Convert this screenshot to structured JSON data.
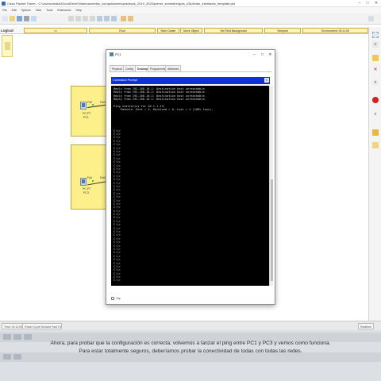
{
  "window": {
    "title": "Cisco Packet Tracer - C:\\Users\\cristia\\iCloudDrive\\Sistemas\\redes_computadores\\practicas_2019_2020\\primer_semestre\\guia_03\\pt\\vlan_interfaces_template.pkt"
  },
  "menu": [
    "File",
    "Edit",
    "Options",
    "View",
    "Tools",
    "Extensions",
    "Help"
  ],
  "workspace": {
    "mode": "Logical",
    "root": "Root",
    "new_cluster": "New Cluster",
    "move_object": "Move Object",
    "set_tiled_background": "Set Tiled Background",
    "viewport": "Viewport",
    "environment": "Environment: 00:11:00"
  },
  "topology": {
    "devices": [
      {
        "label": "PC-PT",
        "name": "PC1",
        "port": "Fa0",
        "switch_port": "Fa0/2"
      },
      {
        "label": "PC-PT",
        "name": "PC3",
        "port": "Fa0",
        "switch_port": "Fa0/4"
      }
    ]
  },
  "dialog": {
    "title": "PC1",
    "tabs": [
      "Physical",
      "Config",
      "Desktop",
      "Programming",
      "Attributes"
    ],
    "active_tab": "Desktop",
    "panel_title": "Command Prompt",
    "panel_close": "X",
    "terminal_lines": [
      "Reply from 192.168.10.1: Destination host unreachable.",
      "Reply from 192.168.10.1: Destination host unreachable.",
      "Reply from 192.168.10.1: Destination host unreachable.",
      "Reply from 192.168.10.1: Destination host unreachable.",
      "",
      "Ping statistics for 10.1.1.13:",
      "    Packets: Sent = 4, Received = 0, Lost = 4 (100% loss),",
      "",
      "",
      "",
      "",
      "",
      "C:\\>",
      "C:\\>",
      "C:\\>",
      "C:\\>",
      "C:\\>",
      "C:\\>",
      "C:\\>",
      "C:\\>",
      "C:\\>",
      "C:\\>",
      "C:\\>",
      "C:\\>",
      "C:\\>",
      "C:\\>",
      "C:\\>",
      "C:\\>",
      "C:\\>",
      "C:\\>",
      "C:\\>",
      "C:\\>",
      "C:\\>",
      "C:\\>",
      "C:\\>",
      "C:\\>",
      "C:\\>",
      "C:\\>",
      "C:\\>",
      "C:\\>",
      "C:\\>",
      "C:\\>",
      "C:\\>",
      "C:\\>",
      "C:\\>",
      "C:\\>",
      "C:\\>",
      "C:\\>",
      "C:\\>",
      "C:\\>",
      "C:\\>",
      "C:\\>",
      "C:\\>",
      "C:\\>",
      "C:\\>",
      "C:\\>"
    ],
    "top_checkbox": "Top"
  },
  "bottom": {
    "time": "Time: 00:11:00",
    "realtime": "Realtime",
    "status_segment": "Power Cycle Devices  Fast Forward Time"
  },
  "subtitles": [
    "Ahora, para probar que la configuración es correcta, volvemos a lanzar el ping entre PC1 y PC3 y vemos como funciona.",
    "Para estar totalmente seguros, deberíamos probar la conectividad de todas con todas las redes."
  ],
  "colors": {
    "zone_fill": "#fdf08a",
    "panel_header": "#0b33d6",
    "terminal_bg": "#000000",
    "link_up": "#19b21f"
  }
}
